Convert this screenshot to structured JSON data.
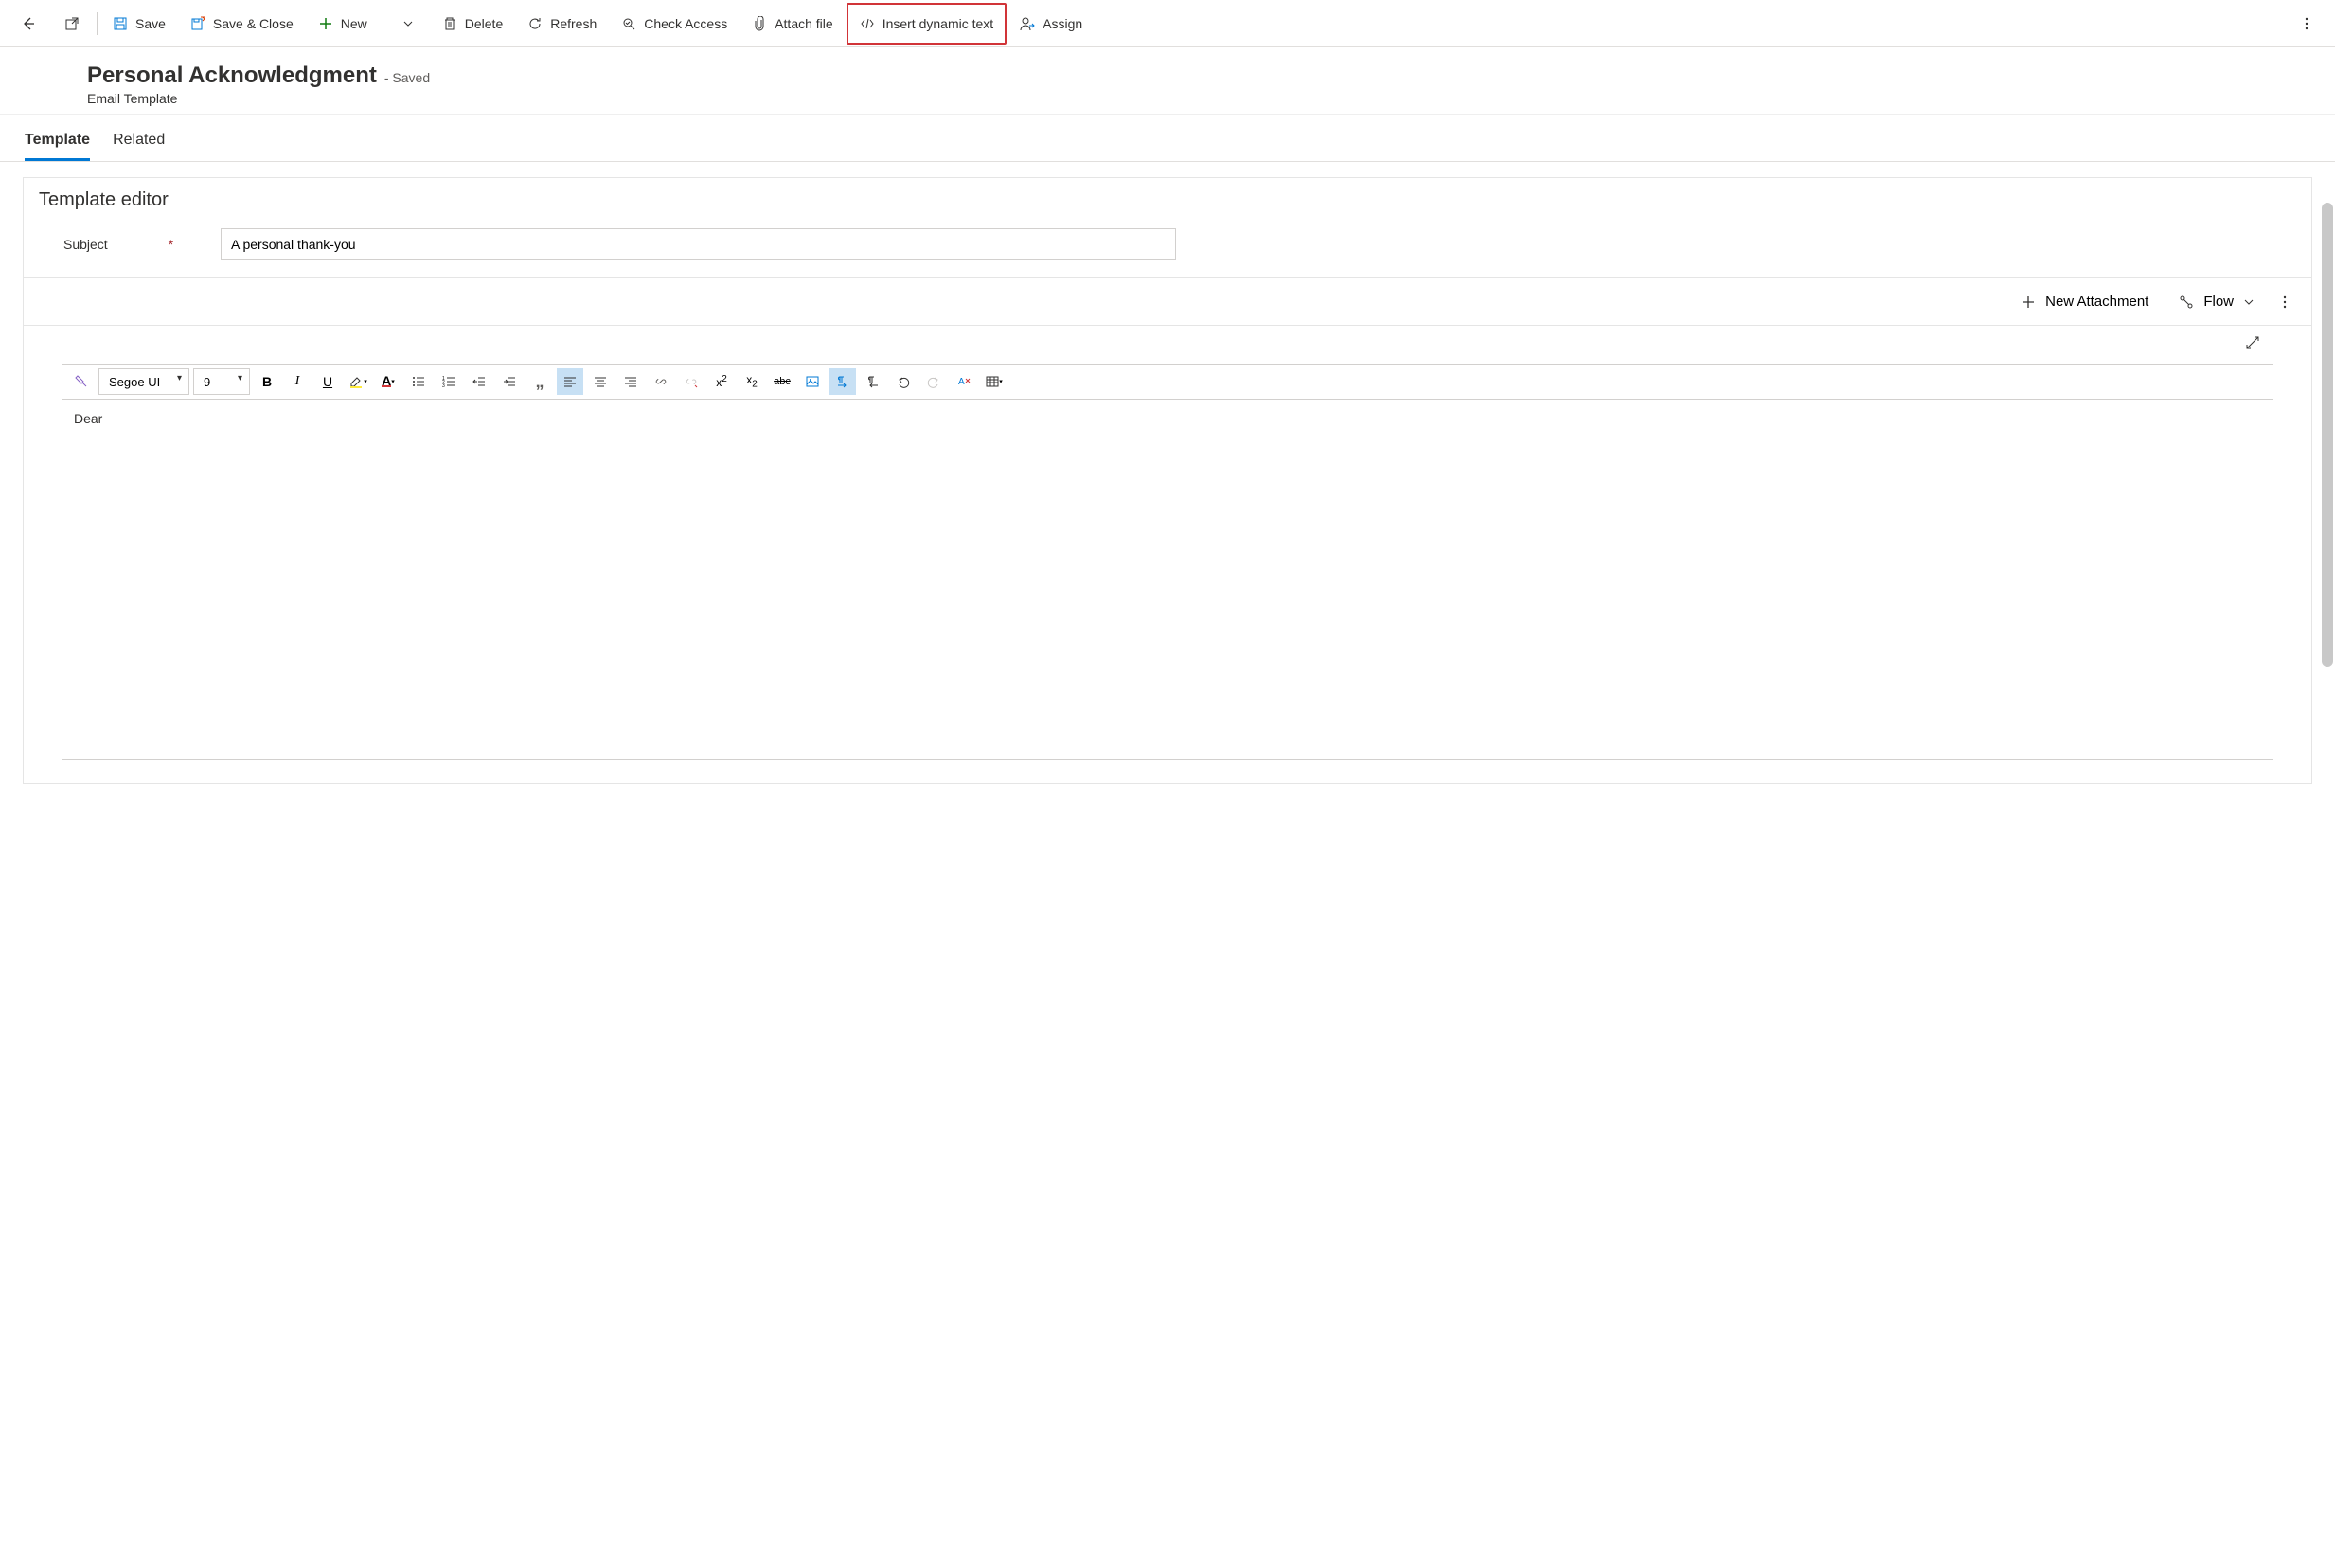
{
  "commandBar": {
    "save": "Save",
    "saveClose": "Save & Close",
    "new": "New",
    "delete": "Delete",
    "refresh": "Refresh",
    "checkAccess": "Check Access",
    "attachFile": "Attach file",
    "insertDynamic": "Insert dynamic text",
    "assign": "Assign"
  },
  "header": {
    "title": "Personal Acknowledgment",
    "status": "- Saved",
    "entity": "Email Template"
  },
  "tabs": {
    "template": "Template",
    "related": "Related"
  },
  "card": {
    "title": "Template editor",
    "subjectLabel": "Subject",
    "subjectValue": "A personal thank-you"
  },
  "attachBar": {
    "newAttachment": "New Attachment",
    "flow": "Flow"
  },
  "rte": {
    "fontName": "Segoe UI",
    "fontSize": "9",
    "body": "Dear"
  }
}
